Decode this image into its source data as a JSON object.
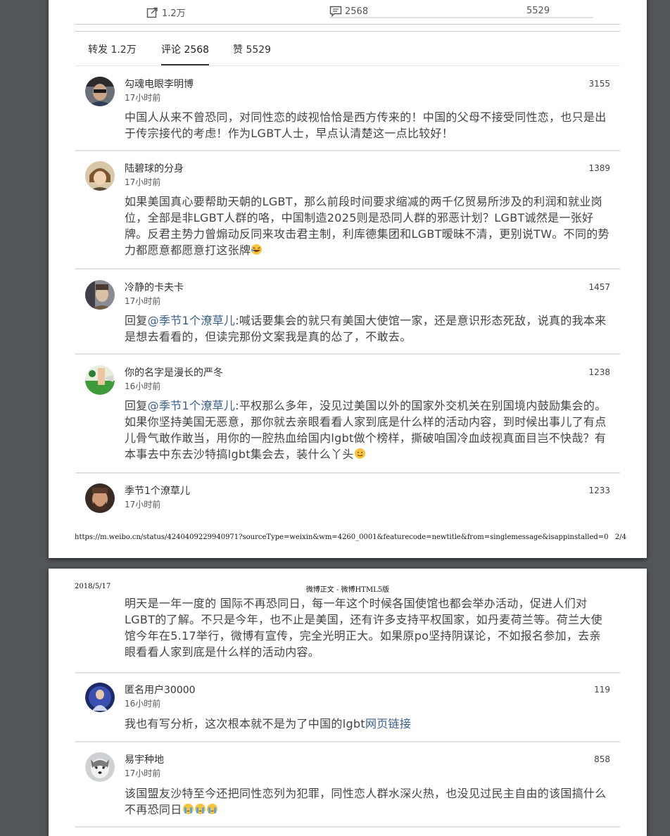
{
  "page1": {
    "actions": {
      "repost": "1.2万",
      "comment": "2568",
      "like": "5529"
    },
    "tabs": [
      {
        "label": "转发 1.2万"
      },
      {
        "label": "评论 2568"
      },
      {
        "label": "赞 5529"
      }
    ],
    "comments": [
      {
        "user": "勾魂电眼李明博",
        "time": "17小时前",
        "likes": "3155",
        "text": "中国人从来不曾恐同，对同性恋的歧视恰恰是西方传来的！中国的父母不接受同性恋，也只是出于传宗接代的考虑！作为LGBT人士，早点认清楚这一点比较好！"
      },
      {
        "user": "陆碧球的分身",
        "time": "17小时前",
        "likes": "1389",
        "text": "如果美国真心要帮助天朝的LGBT，那么前段时间要求缩减的两千亿贸易所涉及的利润和就业岗位，全部是非LGBT人群的咯，中国制造2025则是恐同人群的邪恶计划？LGBT诚然是一张好牌。反君主势力曾煽动反同来攻击君主制，利库德集团和LGBT暧昧不清，更别说TW。不同的势力都愿意都愿意打这张牌"
      },
      {
        "user": "冷静的卡夫卡",
        "time": "17小时前",
        "likes": "1457",
        "prefix": "回复",
        "mention": "@季节1个潦草儿",
        "text": ":喊话要集会的就只有美国大使馆一家，还是意识形态死敌，说真的我本来是想去看看的，但读完那份文案我是真的怂了，不敢去。"
      },
      {
        "user": "你的名字是漫长的严冬",
        "time": "16小时前",
        "likes": "1238",
        "prefix": "回复",
        "mention": "@季节1个潦草儿",
        "text": ":平权那么多年，没见过美国以外的国家外交机关在别国境内鼓励集会的。如果你坚持美国无恶意，那你就去亲眼看看人家到底是什么样的活动内容，到时候出事儿了有点儿骨气敢作敢当，用你的一腔热血给国内lgbt做个榜样，撕破咱国冷血歧视真面目岂不快哉？有本事去中东去沙特搞lgbt集会去，装什么丫头"
      },
      {
        "user": "季节1个潦草儿",
        "time": "17小时前",
        "likes": "1233"
      }
    ],
    "footer_url": "https://m.weibo.cn/status/4240409229940971?sourceType=weixin&wm=4260_0001&featurecode=newtitle&from=singlemessage&isappinstalled=0",
    "footer_page": "2/4"
  },
  "page2": {
    "date": "2018/5/17",
    "title": "微博正文 - 微博HTML5版",
    "continued_text": "明天是一年一度的 国际不再恐同日，每一年这个时候各国使馆也都会举办活动，促进人们对LGBT的了解。不只是今年，也不止是美国，还有许多支持平权国家，如丹麦荷兰等。荷兰大使馆今年在5.17举行，微博有宣传，完全光明正大。如果原po坚持阴谋论，不如报名参加，去亲眼看看人家到底是什么样的活动内容。",
    "comments": [
      {
        "user": "匿名用户30000",
        "time": "16小时前",
        "likes": "119",
        "text": "我也有写分析，这次根本就不是为了中国的lgbt",
        "link": "网页链接"
      },
      {
        "user": "易宇种地",
        "time": "17小时前",
        "likes": "858",
        "text": "该国盟友沙特至今还把同性恋列为犯罪，同性恋人群水深火热，也没见过民主自由的该国搞什么不再恐同日"
      }
    ]
  },
  "colors": {
    "background": "#525659",
    "page": "#ffffff",
    "mention": "#3a5f8b",
    "text": "#444444"
  },
  "icons": [
    "repost-icon",
    "comment-icon",
    "laugh-cry-emoji",
    "smile-emoji",
    "crying-emoji"
  ]
}
